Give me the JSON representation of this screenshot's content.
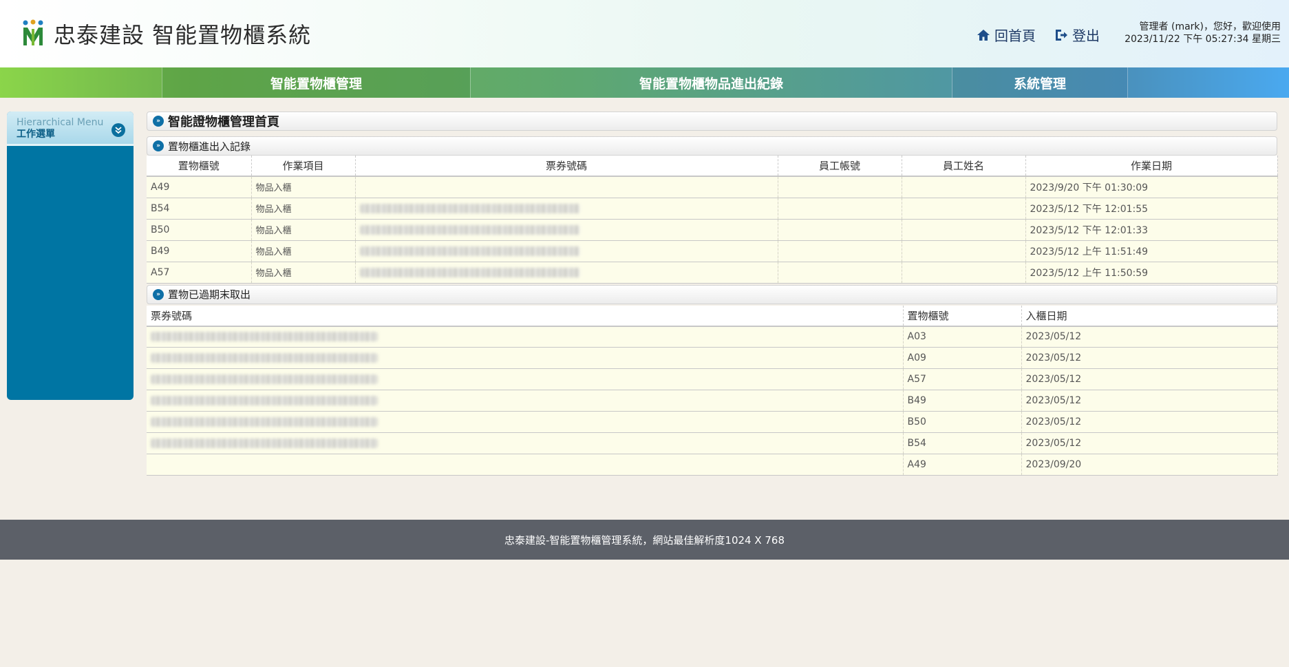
{
  "header": {
    "brand": "忠泰建設 智能置物櫃系統",
    "home_label": "回首頁",
    "logout_label": "登出",
    "greeting": "管理者 (mark)，您好，歡迎使用",
    "datetime": "2023/11/22 下午 05:27:34 星期三"
  },
  "nav": {
    "items": [
      {
        "label": "智能置物櫃管理"
      },
      {
        "label": "智能置物櫃物品進出紀錄"
      },
      {
        "label": "系統管理"
      }
    ]
  },
  "sidebar": {
    "title_en": "Hierarchical Menu",
    "title_zh": "工作選單"
  },
  "main": {
    "page_title": "智能證物櫃管理首頁",
    "section1": {
      "title": "置物櫃進出入記錄",
      "columns": [
        "置物櫃號",
        "作業項目",
        "票券號碼",
        "員工帳號",
        "員工姓名",
        "作業日期"
      ],
      "rows": [
        {
          "locker": "A49",
          "op": "物品入櫃",
          "date": "2023/9/20 下午 01:30:09"
        },
        {
          "locker": "B54",
          "op": "物品入櫃",
          "date": "2023/5/12 下午 12:01:55"
        },
        {
          "locker": "B50",
          "op": "物品入櫃",
          "date": "2023/5/12 下午 12:01:33"
        },
        {
          "locker": "B49",
          "op": "物品入櫃",
          "date": "2023/5/12 上午 11:51:49"
        },
        {
          "locker": "A57",
          "op": "物品入櫃",
          "date": "2023/5/12 上午 11:50:59"
        }
      ]
    },
    "section2": {
      "title": "置物已過期末取出",
      "columns": [
        "票券號碼",
        "置物櫃號",
        "入櫃日期"
      ],
      "rows": [
        {
          "locker": "A03",
          "date": "2023/05/12"
        },
        {
          "locker": "A09",
          "date": "2023/05/12"
        },
        {
          "locker": "A57",
          "date": "2023/05/12"
        },
        {
          "locker": "B49",
          "date": "2023/05/12"
        },
        {
          "locker": "B50",
          "date": "2023/05/12"
        },
        {
          "locker": "B54",
          "date": "2023/05/12"
        },
        {
          "locker": "A49",
          "date": "2023/09/20"
        }
      ]
    }
  },
  "footer": {
    "text": "忠泰建設-智能置物櫃管理系統，網站最佳解析度1024 X 768"
  },
  "colors": {
    "nav_start": "#8bd54a",
    "nav_end": "#4aa9f0",
    "sidebar": "#0075a3",
    "row_bg": "#fdfdea",
    "footer_bg": "#5c6068"
  }
}
